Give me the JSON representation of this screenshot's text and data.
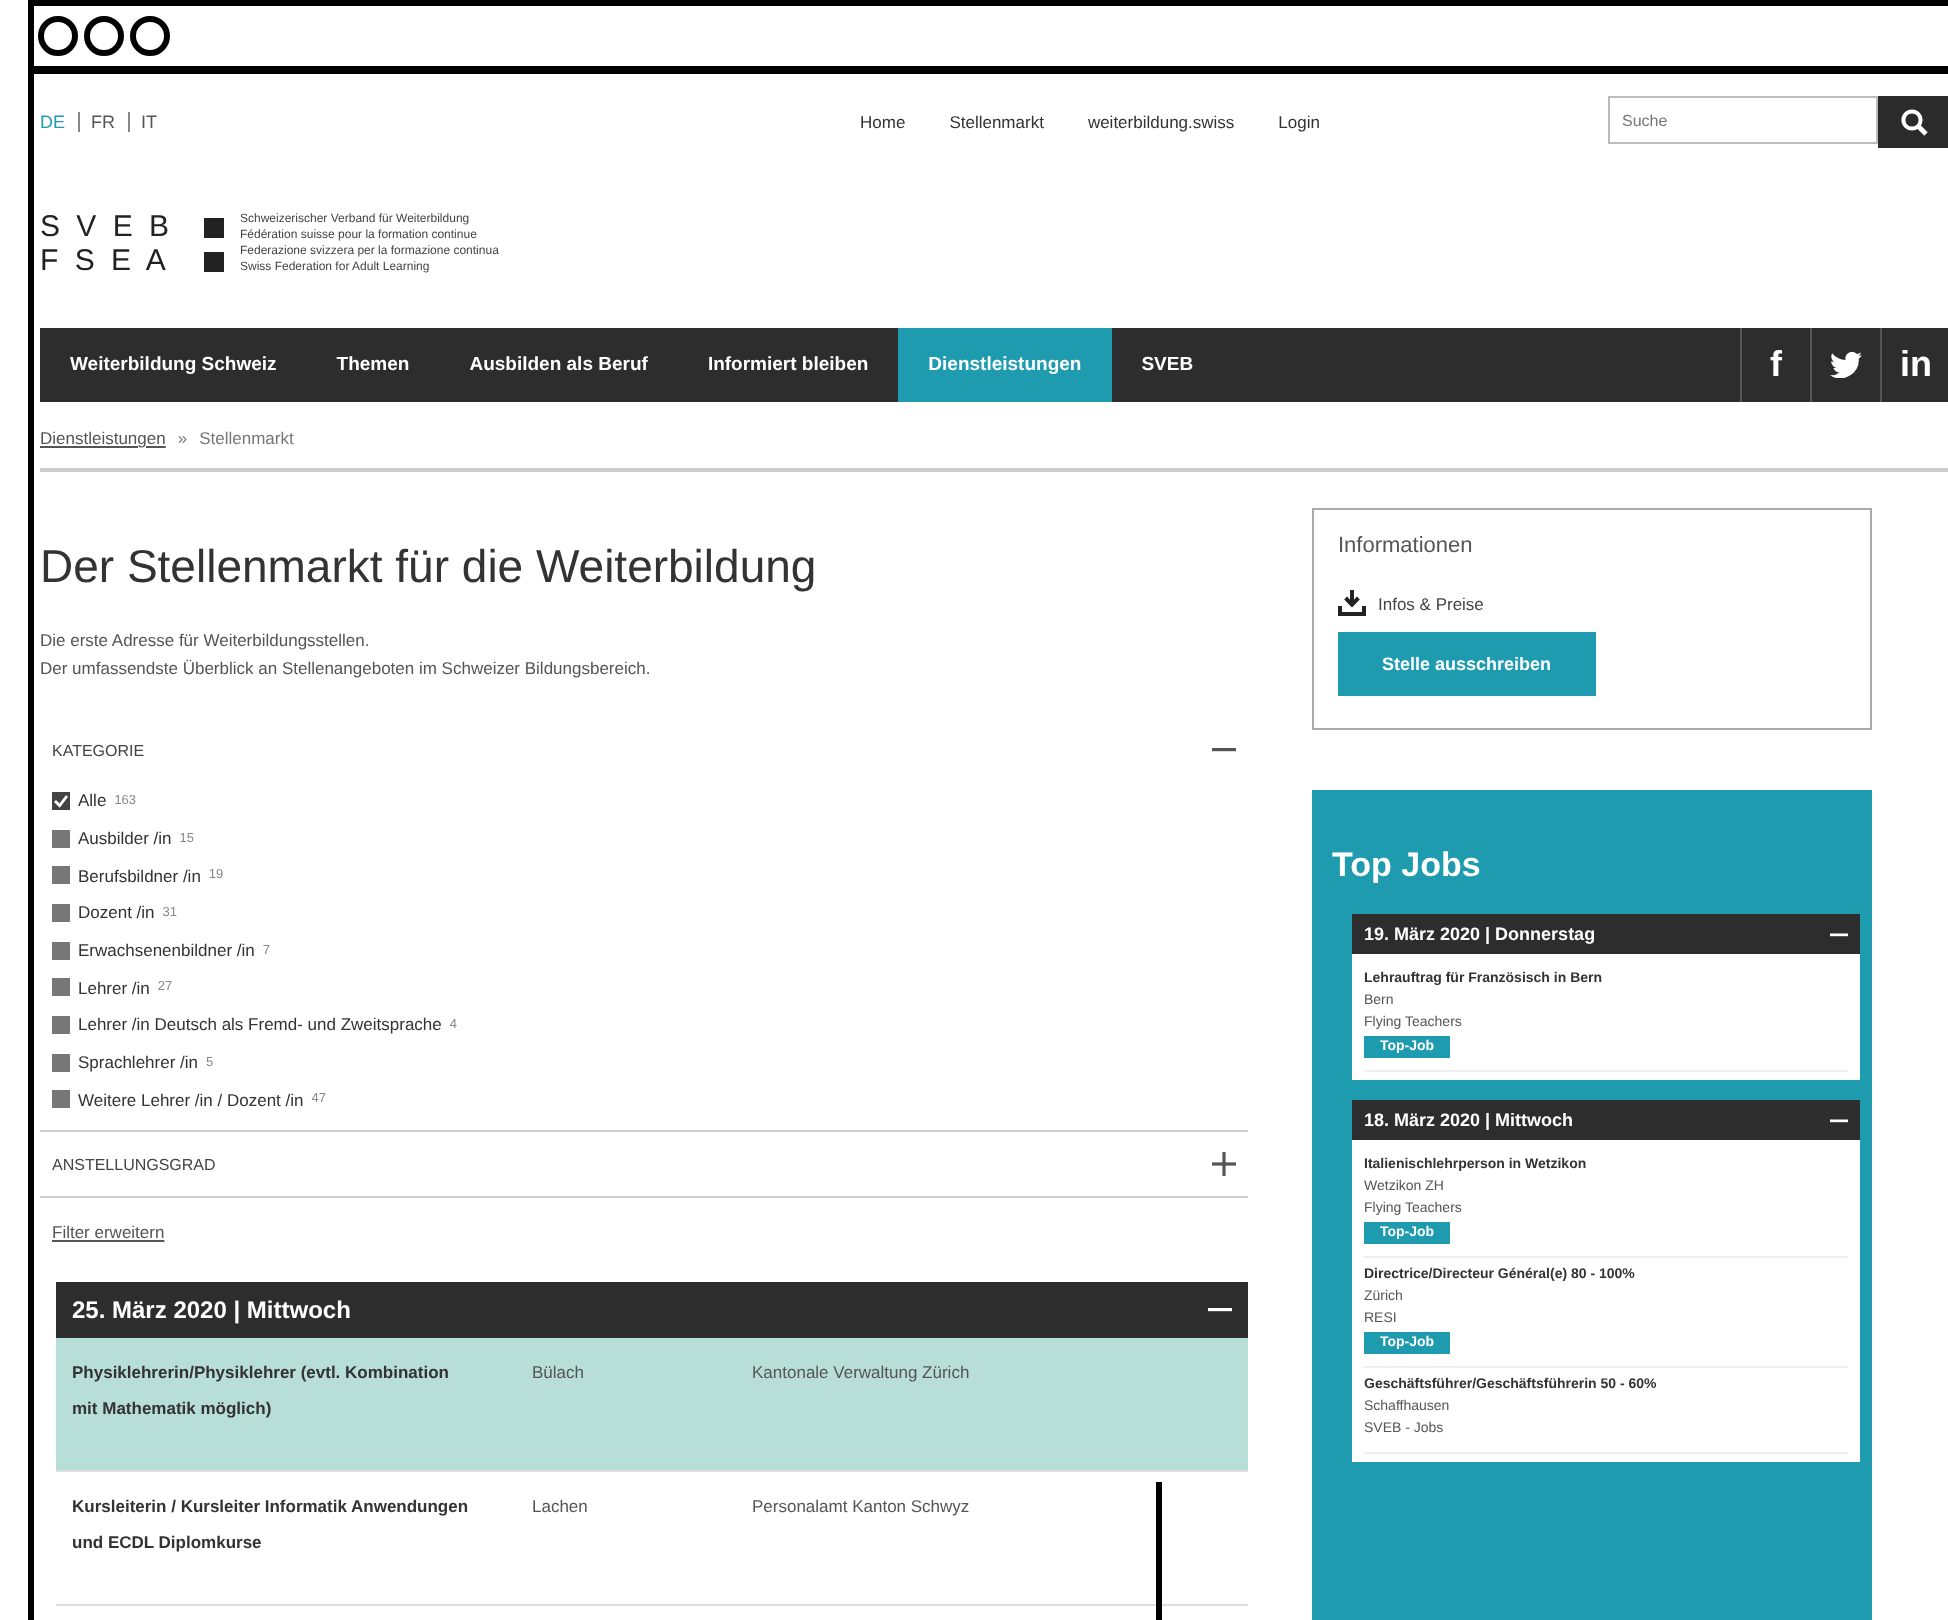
{
  "languages": [
    {
      "label": "DE",
      "selected": true
    },
    {
      "label": "FR",
      "selected": false
    },
    {
      "label": "IT",
      "selected": false
    }
  ],
  "top_links": [
    "Home",
    "Stellenmarkt",
    "weiterbildung.swiss",
    "Login"
  ],
  "search": {
    "placeholder": "Suche"
  },
  "logo": {
    "rows": [
      "S V E B",
      "F S E A"
    ],
    "lines": [
      "Schweizerischer Verband für Weiterbildung",
      "Fédération suisse pour la formation continue",
      "Federazione svizzera per la formazione continua",
      "Swiss Federation for Adult Learning"
    ]
  },
  "nav": [
    {
      "label": "Weiterbildung Schweiz",
      "selected": false
    },
    {
      "label": "Themen",
      "selected": false
    },
    {
      "label": "Ausbilden als Beruf",
      "selected": false
    },
    {
      "label": "Informiert bleiben",
      "selected": false
    },
    {
      "label": "Dienstleistungen",
      "selected": true
    },
    {
      "label": "SVEB",
      "selected": false
    }
  ],
  "social": [
    {
      "kind": "letter",
      "label": "f"
    },
    {
      "kind": "bird"
    },
    {
      "kind": "letter",
      "label": "in"
    }
  ],
  "breadcrumb": {
    "link": "Dienstleistungen",
    "separator": "»",
    "current": "Stellenmarkt"
  },
  "title": "Der Stellenmarkt für die Weiterbildung",
  "intro": [
    "Die erste Adresse für Weiterbildungsstellen.",
    "Der umfassendste Überblick an Stellenangeboten im Schweizer Bildungsbereich."
  ],
  "filters": [
    {
      "label": "KATEGORIE",
      "expanded": true,
      "options": [
        {
          "label": "Alle",
          "count": "163",
          "checked": true
        },
        {
          "label": "Ausbilder /in",
          "count": "15",
          "checked": false
        },
        {
          "label": "Berufsbildner /in",
          "count": "19",
          "checked": false
        },
        {
          "label": "Dozent /in",
          "count": "31",
          "checked": false
        },
        {
          "label": "Erwachsenenbildner /in",
          "count": "7",
          "checked": false
        },
        {
          "label": "Lehrer /in",
          "count": "27",
          "checked": false
        },
        {
          "label": "Lehrer /in Deutsch als Fremd- und Zweitsprache",
          "count": "4",
          "checked": false
        },
        {
          "label": "Sprachlehrer /in",
          "count": "5",
          "checked": false
        },
        {
          "label": "Weitere Lehrer /in / Dozent /in",
          "count": "47",
          "checked": false
        }
      ]
    },
    {
      "label": "ANSTELLUNGSGRAD",
      "expanded": false
    }
  ],
  "filter_link": "Filter erweitern",
  "job_groups": [
    {
      "date": "25. März 2020 | Mittwoch",
      "expanded": true,
      "jobs": [
        {
          "title": "Physiklehrerin/Physiklehrer (evtl. Kombination mit Mathematik möglich)",
          "location": "Bülach",
          "employer": "Kantonale Verwaltung Zürich",
          "highlighted": true
        },
        {
          "title": "Kursleiterin / Kursleiter Informatik Anwendungen und ECDL Diplomkurse",
          "location": "Lachen",
          "employer": "Personalamt Kanton Schwyz",
          "highlighted": false
        }
      ]
    }
  ],
  "info_box": {
    "title": "Informationen",
    "download": "Infos & Preise",
    "button": "Stelle ausschreiben"
  },
  "top_jobs": {
    "title": "Top Jobs",
    "groups": [
      {
        "date": "19. März 2020 | Donnerstag",
        "expanded": true,
        "jobs": [
          {
            "title": "Lehrauftrag für Französisch in Bern",
            "location": "Bern",
            "employer": "Flying Teachers",
            "badge": "Top-Job"
          }
        ]
      },
      {
        "date": "18. März 2020 | Mittwoch",
        "expanded": true,
        "jobs": [
          {
            "title": "Italienischlehrperson in Wetzikon",
            "location": "Wetzikon ZH",
            "employer": "Flying Teachers",
            "badge": "Top-Job"
          },
          {
            "title": "Directrice/Directeur Général(e) 80 - 100%",
            "location": "Zürich",
            "employer": "RESI",
            "badge": "Top-Job"
          },
          {
            "title": "Geschäftsführer/Geschäftsführerin 50 - 60%",
            "location": "Schaffhausen",
            "employer": "SVEB - Jobs"
          }
        ]
      }
    ]
  }
}
